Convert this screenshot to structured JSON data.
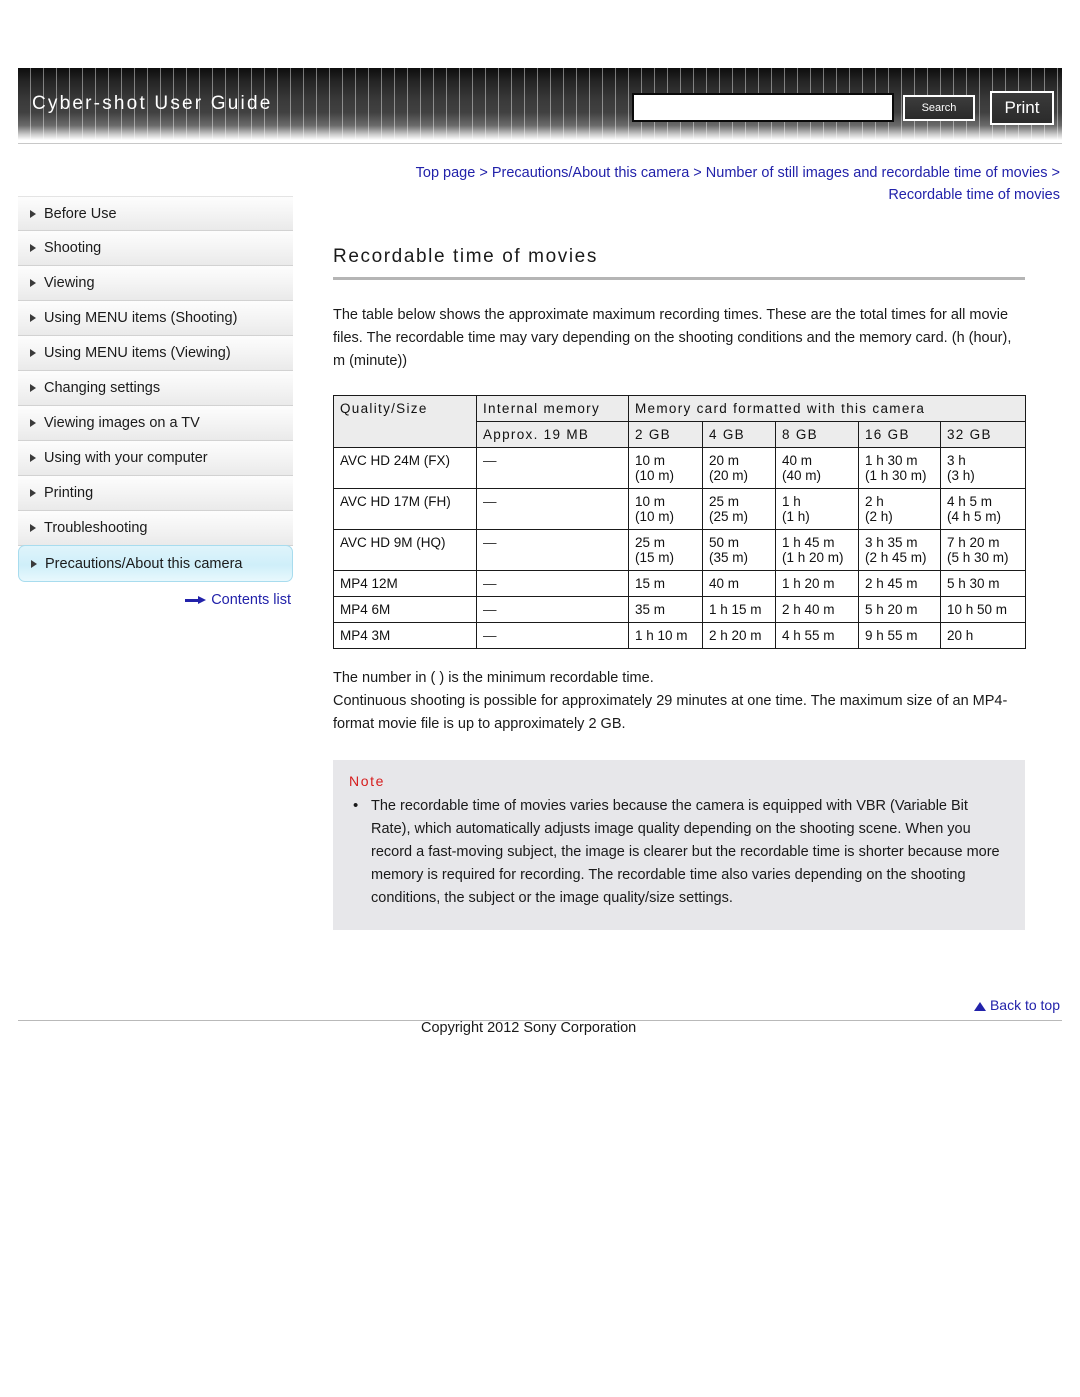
{
  "header": {
    "title": "Cyber-shot User Guide",
    "search_value": "",
    "search_placeholder": "",
    "search_label": "Search",
    "print_label": "Print"
  },
  "breadcrumb": {
    "text": "Top page > Precautions/About this camera > Number of still images and recordable time of movies > Recordable time of movies"
  },
  "sidebar": {
    "items": [
      {
        "label": "Before Use",
        "active": false
      },
      {
        "label": "Shooting",
        "active": false
      },
      {
        "label": "Viewing",
        "active": false
      },
      {
        "label": "Using MENU items (Shooting)",
        "active": false
      },
      {
        "label": "Using MENU items (Viewing)",
        "active": false
      },
      {
        "label": "Changing settings",
        "active": false
      },
      {
        "label": "Viewing images on a TV",
        "active": false
      },
      {
        "label": "Using with your computer",
        "active": false
      },
      {
        "label": "Printing",
        "active": false
      },
      {
        "label": "Troubleshooting",
        "active": false
      },
      {
        "label": "Precautions/About this camera",
        "active": true
      }
    ],
    "contents_link": "Contents list"
  },
  "main": {
    "title": "Recordable time of movies",
    "intro": "The table below shows the approximate maximum recording times. These are the total times for all movie files. The recordable time may vary depending on the shooting conditions and the memory card. (h (hour), m (minute))",
    "after_table_line1": "The number in ( ) is the minimum recordable time.",
    "after_table_line2": "Continuous shooting is possible for approximately 29 minutes at one time. The maximum size of an MP4-format movie file is up to approximately 2 GB."
  },
  "table": {
    "group_headers": {
      "quality_size": "Quality/Size",
      "internal_memory": "Internal memory",
      "memory_card": "Memory card formatted with this camera"
    },
    "sub_headers": [
      "Approx. 19 MB",
      "2 GB",
      "4 GB",
      "8 GB",
      "16 GB",
      "32 GB"
    ],
    "rows": [
      {
        "quality": "AVC HD 24M (FX)",
        "internal": "—",
        "cells": [
          {
            "main": "10 m",
            "min": "(10 m)"
          },
          {
            "main": "20 m",
            "min": "(20 m)"
          },
          {
            "main": "40 m",
            "min": "(40 m)"
          },
          {
            "main": "1 h 30 m",
            "min": "(1 h 30 m)"
          },
          {
            "main": "3 h",
            "min": "(3 h)"
          }
        ]
      },
      {
        "quality": "AVC HD 17M (FH)",
        "internal": "—",
        "cells": [
          {
            "main": "10 m",
            "min": "(10 m)"
          },
          {
            "main": "25 m",
            "min": "(25 m)"
          },
          {
            "main": "1 h",
            "min": "(1 h)"
          },
          {
            "main": "2 h",
            "min": "(2 h)"
          },
          {
            "main": "4 h 5 m",
            "min": "(4 h 5 m)"
          }
        ]
      },
      {
        "quality": "AVC HD 9M (HQ)",
        "internal": "—",
        "cells": [
          {
            "main": "25 m",
            "min": "(15 m)"
          },
          {
            "main": "50 m",
            "min": "(35 m)"
          },
          {
            "main": "1 h 45 m",
            "min": "(1 h 20 m)"
          },
          {
            "main": "3 h 35 m",
            "min": "(2 h 45 m)"
          },
          {
            "main": "7 h 20 m",
            "min": "(5 h 30 m)"
          }
        ]
      },
      {
        "quality": "MP4 12M",
        "internal": "—",
        "cells": [
          {
            "main": "15 m",
            "min": ""
          },
          {
            "main": "40 m",
            "min": ""
          },
          {
            "main": "1 h 20 m",
            "min": ""
          },
          {
            "main": "2 h 45 m",
            "min": ""
          },
          {
            "main": "5 h 30 m",
            "min": ""
          }
        ]
      },
      {
        "quality": "MP4 6M",
        "internal": "—",
        "cells": [
          {
            "main": "35 m",
            "min": ""
          },
          {
            "main": "1 h 15 m",
            "min": ""
          },
          {
            "main": "2 h 40 m",
            "min": ""
          },
          {
            "main": "5 h 20 m",
            "min": ""
          },
          {
            "main": "10 h 50 m",
            "min": ""
          }
        ]
      },
      {
        "quality": "MP4 3M",
        "internal": "—",
        "cells": [
          {
            "main": "1 h 10 m",
            "min": ""
          },
          {
            "main": "2 h 20 m",
            "min": ""
          },
          {
            "main": "4 h 55 m",
            "min": ""
          },
          {
            "main": "9 h 55 m",
            "min": ""
          },
          {
            "main": "20 h",
            "min": ""
          }
        ]
      }
    ]
  },
  "note": {
    "title": "Note",
    "items": [
      "The recordable time of movies varies because the camera is equipped with VBR (Variable Bit Rate), which automatically adjusts image quality depending on the shooting scene. When you record a fast-moving subject, the image is clearer but the recordable time is shorter because more memory is required for recording. The recordable time also varies depending on the shooting conditions, the subject or the image quality/size settings."
    ]
  },
  "footer": {
    "back_to_top": "Back to top",
    "copyright": "Copyright 2012 Sony Corporation"
  },
  "colors": {
    "link": "#2222aa",
    "note_title": "#d61d1d",
    "active_item_bg": "#cfeff9",
    "header_band": "#2a2a2a"
  }
}
